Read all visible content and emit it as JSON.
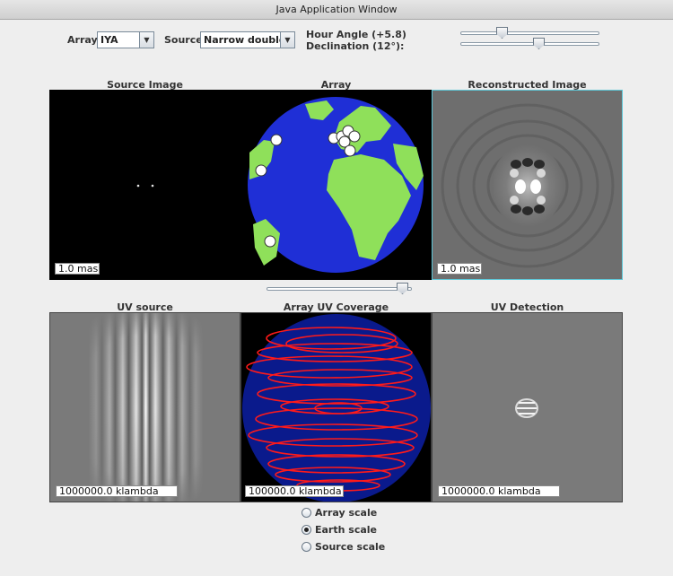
{
  "window": {
    "title": "Java Application Window"
  },
  "controls": {
    "array_label": "Array:",
    "array_value": "IYA",
    "source_label": "Source:",
    "source_value": "Narrow double",
    "hour_angle_label": "Hour Angle (+5.8)",
    "declination_label": "Declination (12°):",
    "hour_angle_position": 0.28,
    "declination_position": 0.57,
    "middle_slider_position": 0.97
  },
  "panels": {
    "source_image": {
      "title": "Source Image",
      "scale": "1.0 mas"
    },
    "array": {
      "title": "Array"
    },
    "reconstructed_image": {
      "title": "Reconstructed Image",
      "scale": "1.0 mas"
    },
    "uv_source": {
      "title": "UV source",
      "scale": "1000000.0 klambda"
    },
    "array_uv_coverage": {
      "title": "Array UV Coverage",
      "scale": "100000.0 klambda"
    },
    "uv_detection": {
      "title": "UV Detection",
      "scale": "1000000.0 klambda"
    }
  },
  "scale_options": [
    {
      "label": "Array scale",
      "selected": false
    },
    {
      "label": "Earth scale",
      "selected": true
    },
    {
      "label": "Source scale",
      "selected": false
    }
  ],
  "colors": {
    "ocean": "#1f2fd6",
    "land": "#8fe05a",
    "uv_disk": "#0a1a8c",
    "uv_tracks": "#ff1a1a",
    "focus_border": "#5ec8d8"
  }
}
